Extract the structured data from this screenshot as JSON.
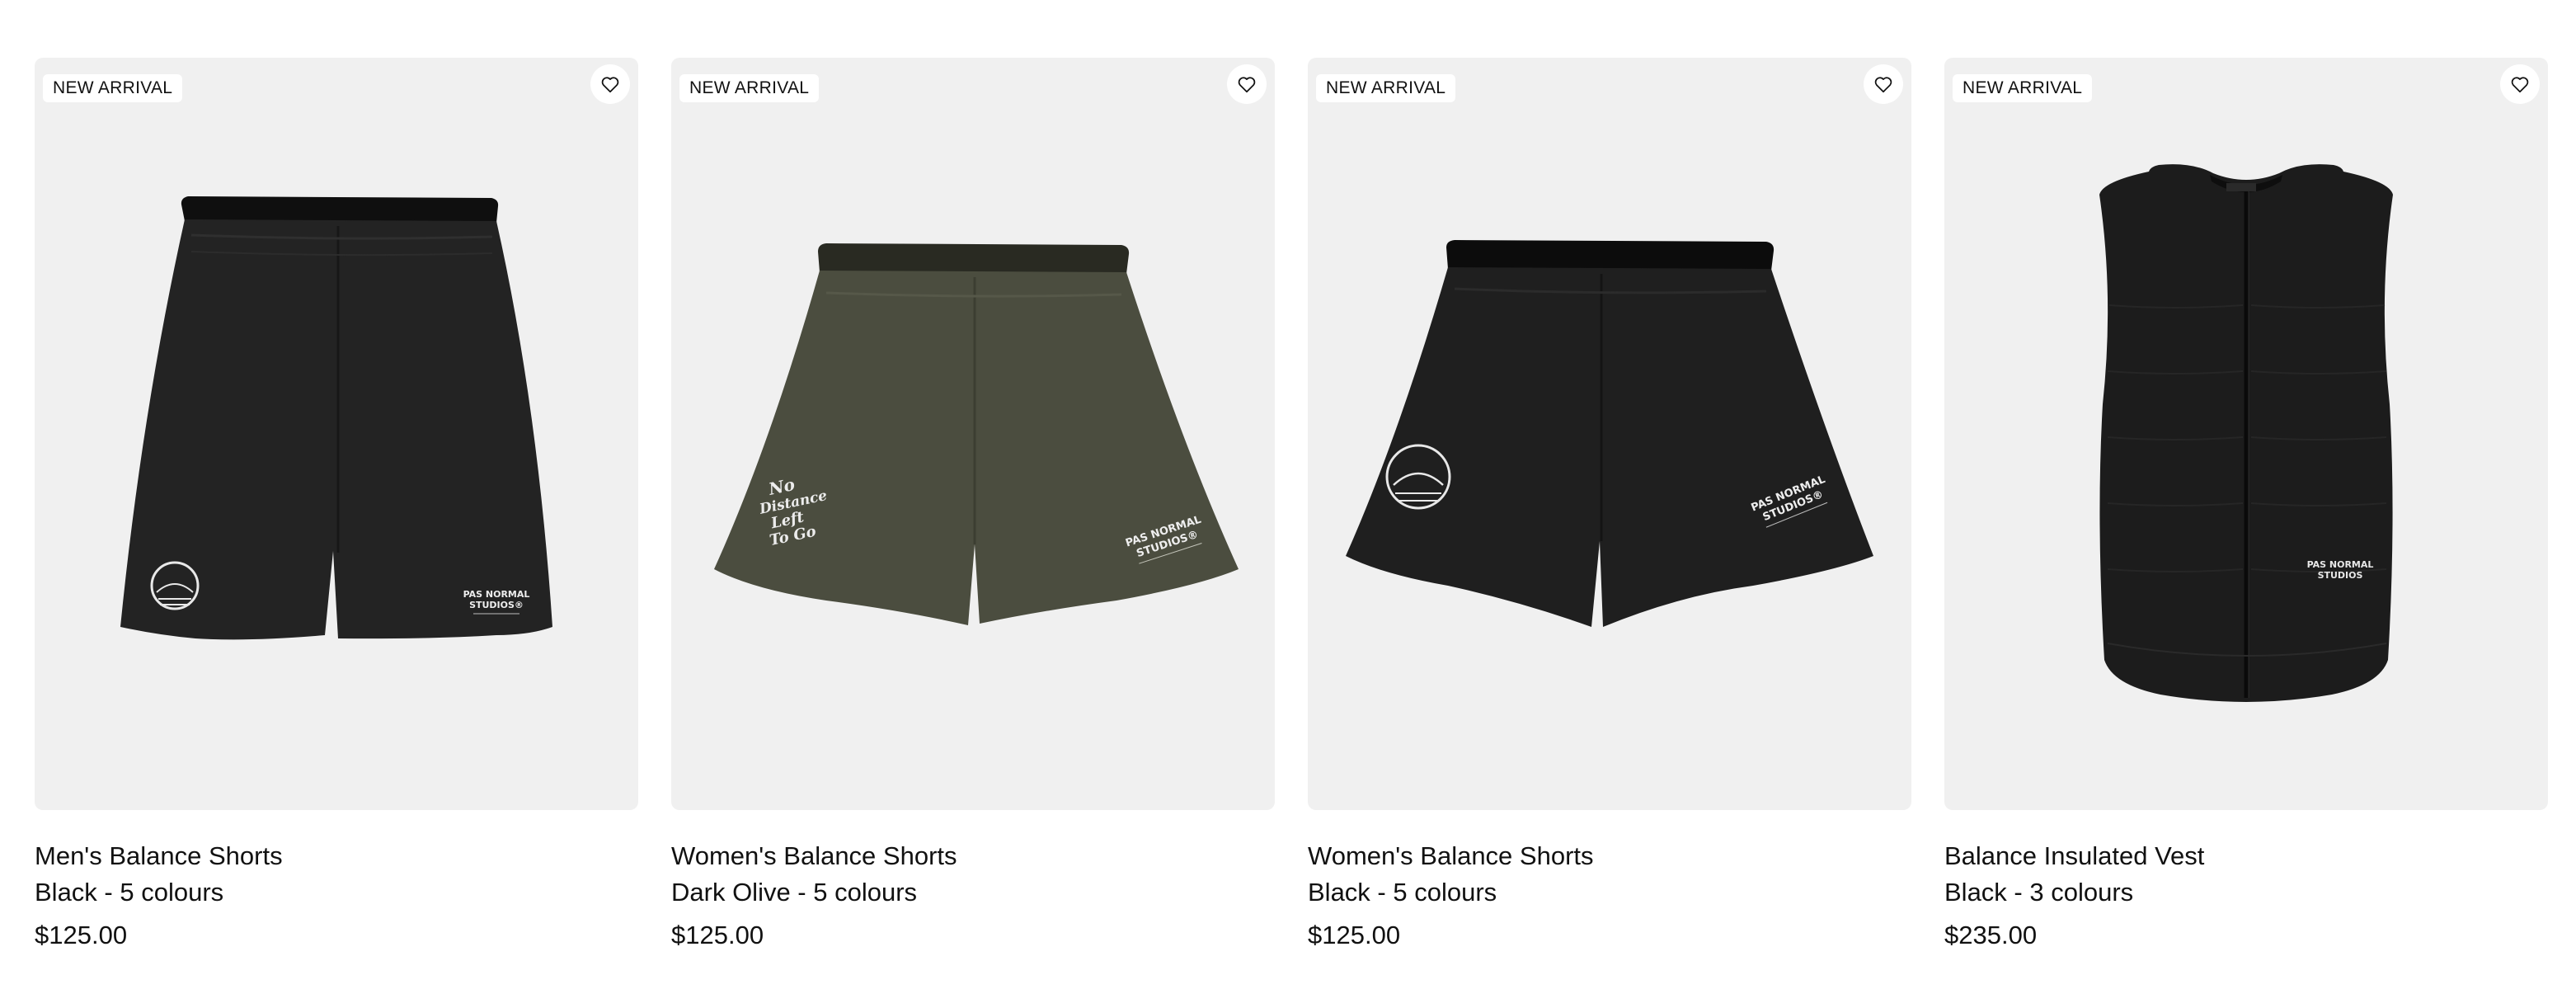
{
  "products": [
    {
      "badge": "NEW ARRIVAL",
      "name": "Men's Balance Shorts",
      "variant": "Black - 5 colours",
      "price": "$125.00",
      "image": "black-mens-shorts",
      "print_lines": [
        "PAS NORMAL",
        "STUDIOS®"
      ],
      "garment_color": "#232323"
    },
    {
      "badge": "NEW ARRIVAL",
      "name": "Women's Balance Shorts",
      "variant": "Dark Olive - 5 colours",
      "price": "$125.00",
      "image": "olive-womens-shorts",
      "print_lines": [
        "PAS NORMAL",
        "STUDIOS®"
      ],
      "slogan_lines": [
        "No",
        "Distance",
        "Left",
        "To Go"
      ],
      "garment_color": "#4b4d3f"
    },
    {
      "badge": "NEW ARRIVAL",
      "name": "Women's Balance Shorts",
      "variant": "Black - 5 colours",
      "price": "$125.00",
      "image": "black-womens-shorts",
      "print_lines": [
        "PAS NORMAL",
        "STUDIOS®"
      ],
      "garment_color": "#1f1f1f"
    },
    {
      "badge": "NEW ARRIVAL",
      "name": "Balance Insulated Vest",
      "variant": "Black - 3 colours",
      "price": "$235.00",
      "image": "black-insulated-vest",
      "print_lines": [
        "PAS NORMAL",
        "STUDIOS"
      ],
      "garment_color": "#1c1c1c"
    }
  ],
  "icons": {
    "wishlist": "heart-outline-icon"
  },
  "colors": {
    "image_background": "#f0f0f0",
    "text": "#111111"
  }
}
